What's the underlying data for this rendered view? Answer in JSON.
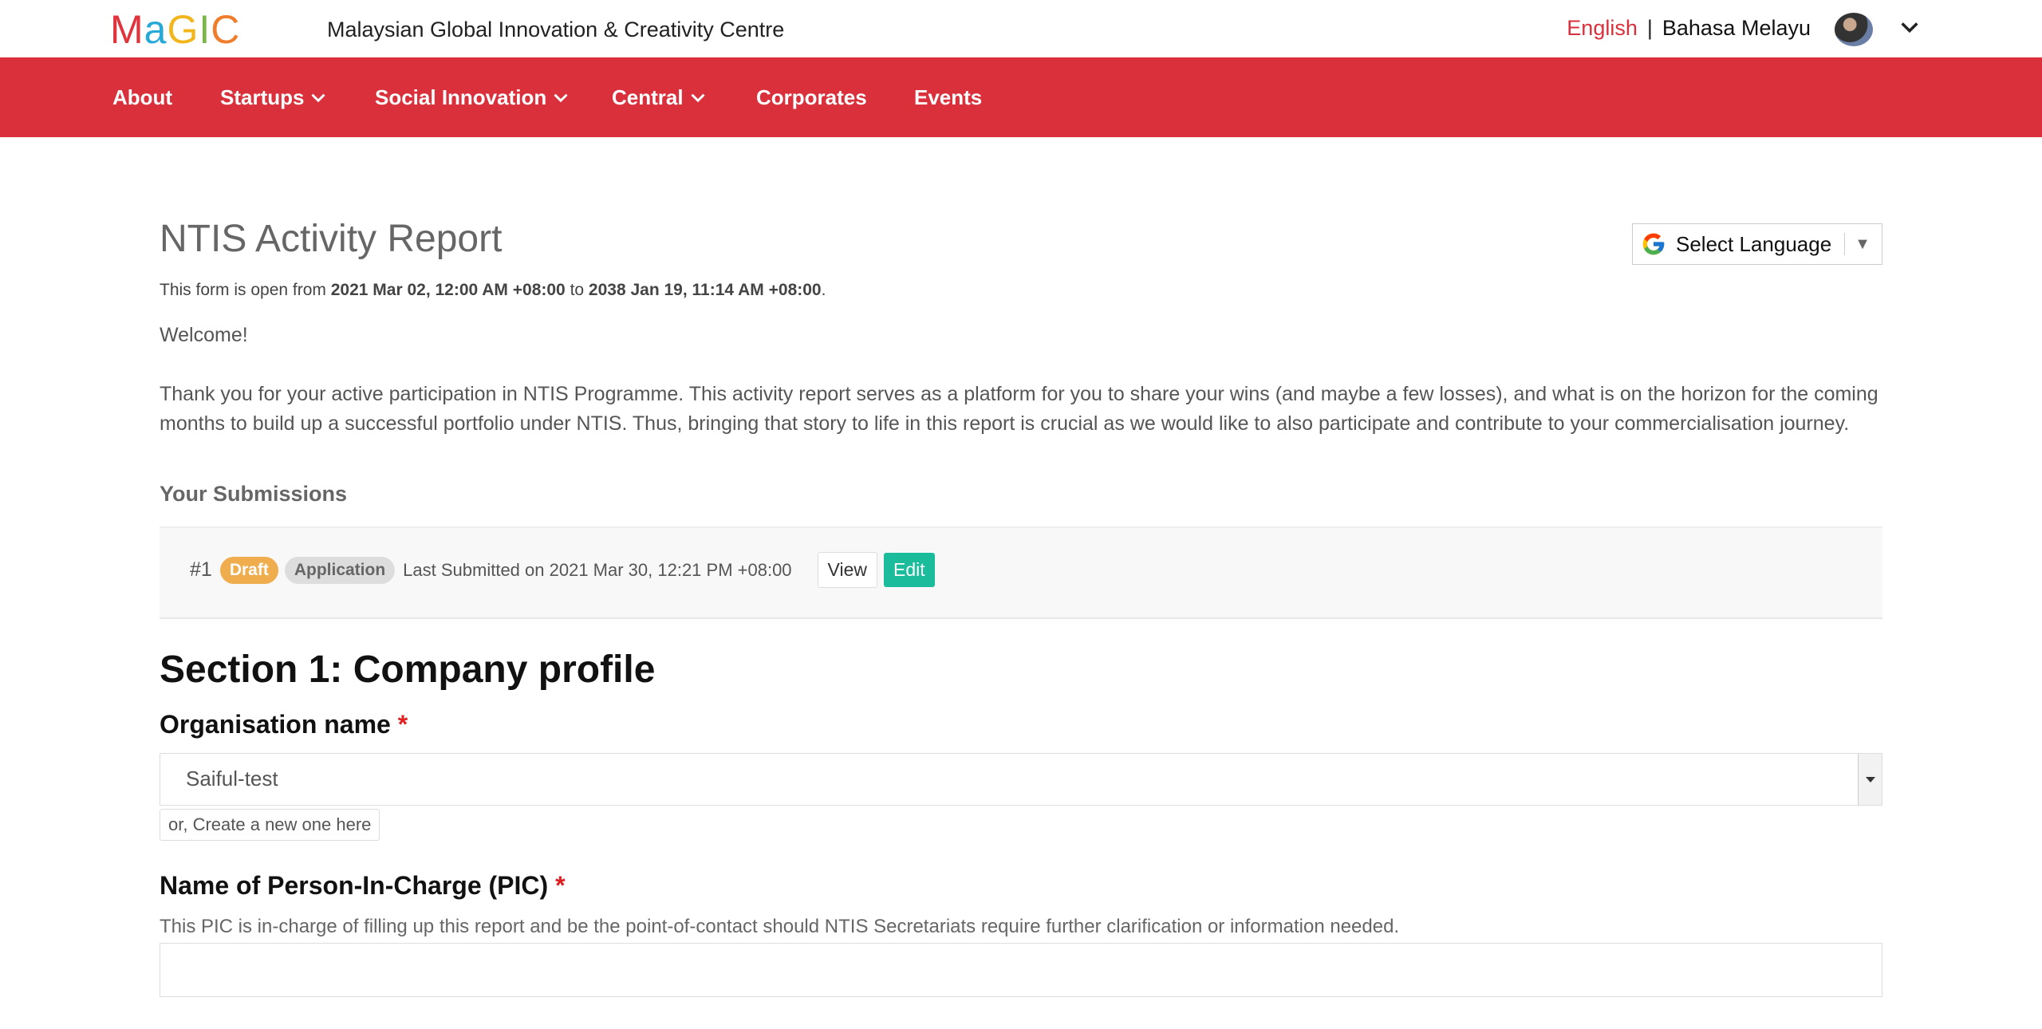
{
  "header": {
    "logo_text": "MaGIC",
    "org_name": "Malaysian Global Innovation & Creativity Centre",
    "lang_en": "English",
    "lang_sep": "|",
    "lang_ms": "Bahasa Melayu"
  },
  "nav": {
    "items": [
      {
        "label": "About"
      },
      {
        "label": "Startups"
      },
      {
        "label": "Social Innovation"
      },
      {
        "label": "Central"
      },
      {
        "label": "Corporates"
      },
      {
        "label": "Events"
      }
    ]
  },
  "page": {
    "title": "NTIS Activity Report",
    "translate_label": "Select Language",
    "open_prefix": "This form is open from ",
    "open_from": "2021 Mar 02, 12:00 AM +08:00",
    "open_mid": " to ",
    "open_to": "2038 Jan 19, 11:14 AM +08:00",
    "open_suffix": ".",
    "welcome": "Welcome!",
    "intro": "Thank you for your active participation in NTIS Programme. This activity report serves as a platform for you to share your wins (and maybe a few losses), and what is on the horizon for the coming months to build up a successful portfolio under NTIS. Thus, bringing that story to life in this report is crucial as we would like to also participate and contribute to your commercialisation journey.",
    "submissions_heading": "Your Submissions"
  },
  "submission": {
    "number": "#1",
    "status_badge": "Draft",
    "type_badge": "Application",
    "last_submitted": "Last Submitted on 2021 Mar 30, 12:21 PM +08:00",
    "view_label": "View",
    "edit_label": "Edit"
  },
  "form": {
    "section_title": "Section 1: Company profile",
    "org_label": "Organisation name",
    "required_mark": "*",
    "org_value": "Saiful-test",
    "create_link": "or, Create a new one here",
    "pic_label": "Name of Person-In-Charge (PIC)",
    "pic_help": "This PIC is in-charge of filling up this report and be the point-of-contact should NTIS Secretariats require further clarification or information needed.",
    "pic_value": ""
  },
  "colors": {
    "brand_red": "#d9303c",
    "draft": "#f0ad4e",
    "edit": "#1abc9c"
  }
}
